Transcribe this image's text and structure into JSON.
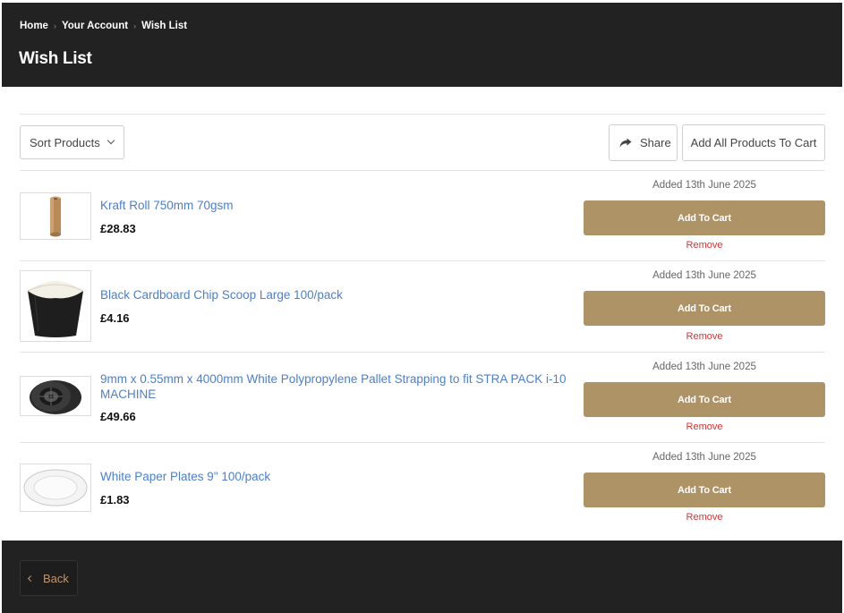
{
  "breadcrumb": {
    "home": "Home",
    "account": "Your Account",
    "current": "Wish List"
  },
  "page": {
    "title": "Wish List"
  },
  "toolbar": {
    "sort_label": "Sort Products",
    "share_label": "Share",
    "add_all_label": "Add All Products To Cart"
  },
  "items": [
    {
      "name": "Kraft Roll 750mm 70gsm",
      "price": "£28.83",
      "added": "Added 13th June 2025",
      "cart_label": "Add To Cart",
      "remove_label": "Remove",
      "image": "kraft-roll"
    },
    {
      "name": "Black Cardboard Chip Scoop Large 100/pack",
      "price": "£4.16",
      "added": "Added 13th June 2025",
      "cart_label": "Add To Cart",
      "remove_label": "Remove",
      "image": "chip-scoop"
    },
    {
      "name": "9mm x 0.55mm x 4000mm White Polypropylene Pallet Strapping to fit STRA PACK i-10 MACHINE",
      "price": "£49.66",
      "added": "Added 13th June 2025",
      "cart_label": "Add To Cart",
      "remove_label": "Remove",
      "image": "strapping-coil"
    },
    {
      "name": "White Paper Plates 9\" 100/pack",
      "price": "£1.83",
      "added": "Added 13th June 2025",
      "cart_label": "Add To Cart",
      "remove_label": "Remove",
      "image": "paper-plate"
    }
  ],
  "footer": {
    "back_label": "Back"
  },
  "colors": {
    "header_bg": "#222222",
    "accent_button": "#ad9366",
    "link": "#4a7fd4",
    "remove": "#e03131",
    "back_text": "#c7956a"
  }
}
